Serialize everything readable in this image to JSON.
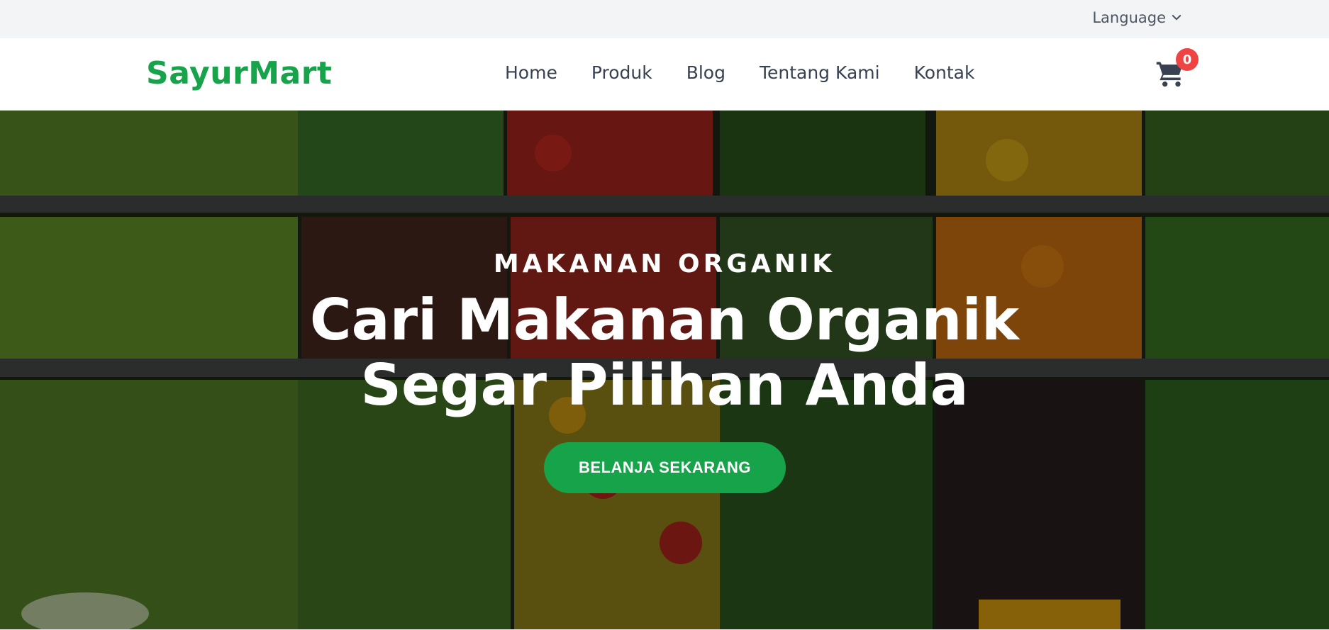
{
  "topbar": {
    "language_label": "Language",
    "language_icon": "chevron-down-icon"
  },
  "header": {
    "logo": "SayurMart",
    "nav": [
      {
        "label": "Home"
      },
      {
        "label": "Produk"
      },
      {
        "label": "Blog"
      },
      {
        "label": "Tentang Kami"
      },
      {
        "label": "Kontak"
      }
    ],
    "cart": {
      "icon": "shopping-cart-icon",
      "count": "0"
    }
  },
  "hero": {
    "eyebrow": "MAKANAN ORGANIK",
    "title_line1": "Cari Makanan Organik",
    "title_line2": "Segar Pilihan Anda",
    "cta_label": "BELANJA SEKARANG",
    "background": "vegetable-shelves-photo"
  },
  "colors": {
    "brand_green": "#16a34a",
    "badge_red": "#ef4444",
    "topbar_bg": "#f3f4f6",
    "nav_text": "#374151"
  }
}
